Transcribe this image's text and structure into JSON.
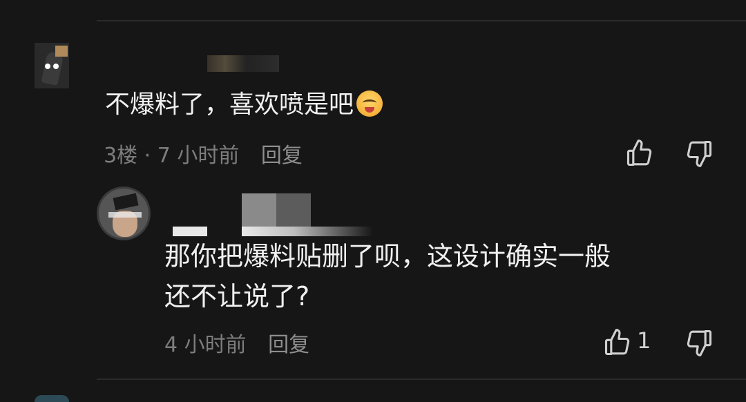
{
  "comment1": {
    "text": "不爆料了，喜欢喷是吧",
    "emoji": "drooling-face-emoji",
    "floor": "3楼",
    "separator": "·",
    "time": "7 小时前",
    "reply_label": "回复"
  },
  "comment2": {
    "text_line1": "那你把爆料贴删了呗，这设计确实一般",
    "text_line2": "还不让说了?",
    "time": "4 小时前",
    "reply_label": "回复",
    "like_count": "1"
  },
  "colors": {
    "background": "#161616",
    "text": "#f0f0f0",
    "meta": "#7d7d7d",
    "icon": "#d0d0d0"
  }
}
